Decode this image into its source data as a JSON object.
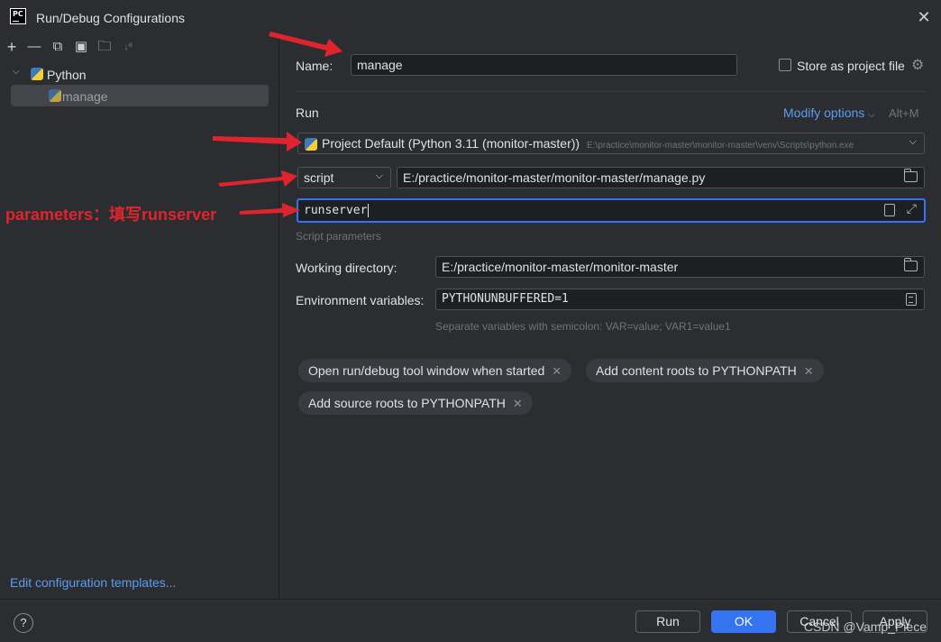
{
  "window": {
    "title": "Run/Debug Configurations",
    "app_icon_text": "PC"
  },
  "toolbar": {
    "icons": [
      "add-icon",
      "remove-icon",
      "copy-icon",
      "save-icon",
      "folder-add-icon",
      "sort-icon"
    ]
  },
  "tree": {
    "group": {
      "label": "Python"
    },
    "item": {
      "label": "manage"
    }
  },
  "left_footer": {
    "link": "Edit configuration templates..."
  },
  "form": {
    "name_label": "Name:",
    "name_value": "manage",
    "store_label": "Store as project file",
    "run_section": "Run",
    "modify_options": "Modify options",
    "modify_shortcut": "Alt+M",
    "interpreter_value": "Project Default (Python 3.11 (monitor-master))",
    "interpreter_path": "E:\\practice\\monitor-master\\monitor-master\\venv\\Scripts\\python.exe",
    "target_type": "script",
    "script_path": "E:/practice/monitor-master/monitor-master/manage.py",
    "script_parameters": "runserver",
    "script_parameters_hint": "Script parameters",
    "working_dir_label": "Working directory:",
    "working_dir_value": "E:/practice/monitor-master/monitor-master",
    "env_label": "Environment variables:",
    "env_value": "PYTHONUNBUFFERED=1",
    "env_hint": "Separate variables with semicolon: VAR=value; VAR1=value1",
    "chips": [
      "Open run/debug tool window when started",
      "Add content roots to PYTHONPATH",
      "Add source roots to PYTHONPATH"
    ]
  },
  "footer": {
    "help": "?",
    "run": "Run",
    "ok": "OK",
    "cancel": "Cancel",
    "apply": "Apply",
    "watermark": "CSDN @Vamp_Piece"
  },
  "annotation": {
    "text": "parameters：填写runserver",
    "color": "#e0242e"
  },
  "colors": {
    "accent": "#3574f0",
    "link": "#5a9df0",
    "background": "#2b2d30"
  }
}
